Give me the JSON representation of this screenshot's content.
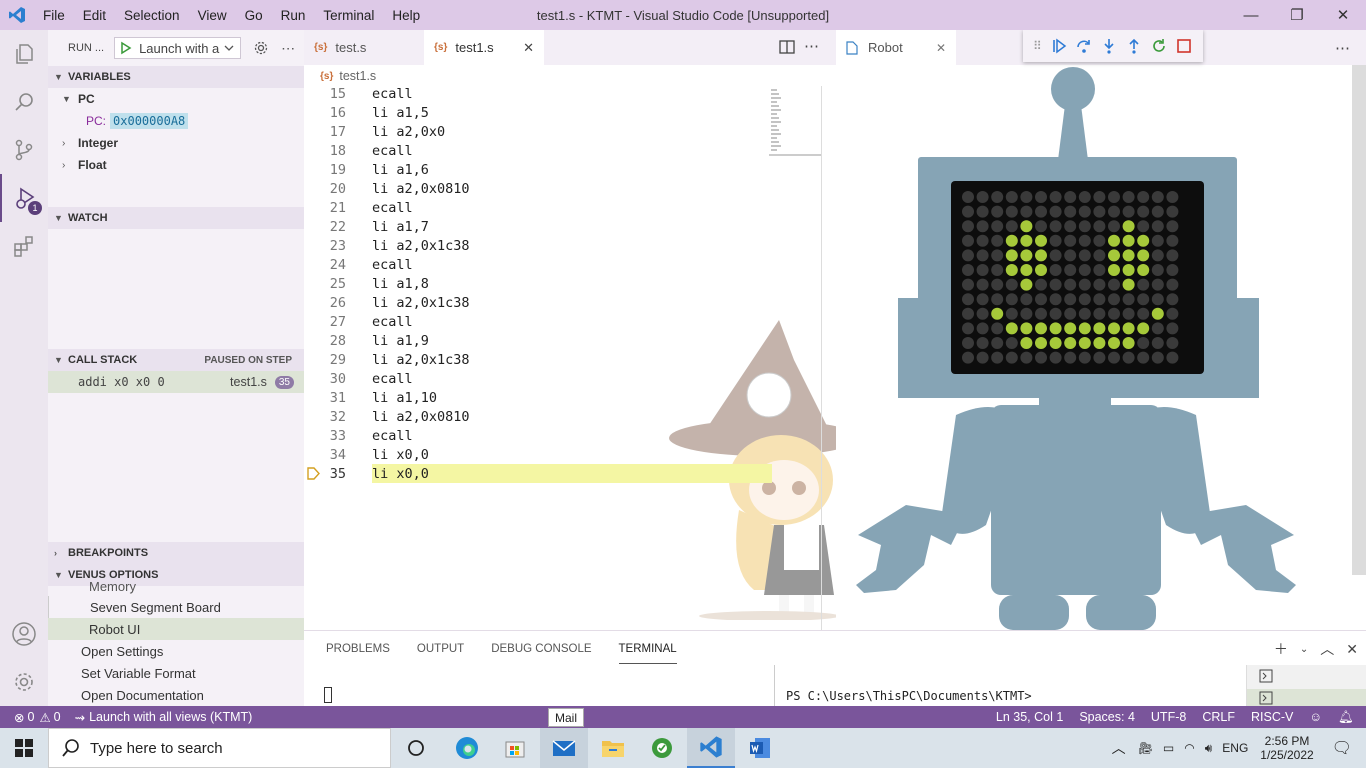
{
  "window": {
    "title": "test1.s - KTMT - Visual Studio Code [Unsupported]",
    "min": "—",
    "max": "❐",
    "close": "✕"
  },
  "menu": [
    "File",
    "Edit",
    "Selection",
    "View",
    "Go",
    "Run",
    "Terminal",
    "Help"
  ],
  "activity": {
    "debug_badge": "1"
  },
  "run": {
    "label": "RUN ...",
    "config": "Launch with a"
  },
  "variables": {
    "header": "VARIABLES",
    "pc_group": "PC",
    "pc_label": "PC:",
    "pc_value": "0x000000A8",
    "integer": "Integer",
    "float": "Float"
  },
  "watch": {
    "header": "WATCH"
  },
  "callstack": {
    "header": "CALL STACK",
    "state": "PAUSED ON STEP",
    "frame": "addi x0 x0 0",
    "file": "test1.s",
    "line": "35"
  },
  "breakpoints": {
    "header": "BREAKPOINTS"
  },
  "venus": {
    "header": "VENUS OPTIONS",
    "items": [
      "Memory",
      "Seven Segment Board",
      "Robot UI",
      "Open Settings",
      "Set Variable Format",
      "Open Documentation"
    ]
  },
  "tabs": [
    {
      "label": "test.s",
      "icon": "{s}"
    },
    {
      "label": "test1.s",
      "icon": "{s}"
    }
  ],
  "breadcrumb": "test1.s",
  "code": [
    {
      "n": "15",
      "t": "ecall"
    },
    {
      "n": "16",
      "t": "li a1,5"
    },
    {
      "n": "17",
      "t": "li a2,0x0"
    },
    {
      "n": "18",
      "t": "ecall"
    },
    {
      "n": "19",
      "t": "li a1,6"
    },
    {
      "n": "20",
      "t": "li a2,0x0810"
    },
    {
      "n": "21",
      "t": "ecall"
    },
    {
      "n": "22",
      "t": "li a1,7"
    },
    {
      "n": "23",
      "t": "li a2,0x1c38"
    },
    {
      "n": "24",
      "t": "ecall"
    },
    {
      "n": "25",
      "t": "li a1,8"
    },
    {
      "n": "26",
      "t": "li a2,0x1c38"
    },
    {
      "n": "27",
      "t": "ecall"
    },
    {
      "n": "28",
      "t": "li a1,9"
    },
    {
      "n": "29",
      "t": "li a2,0x1c38"
    },
    {
      "n": "30",
      "t": "ecall"
    },
    {
      "n": "31",
      "t": "li a1,10"
    },
    {
      "n": "32",
      "t": "li a2,0x0810"
    },
    {
      "n": "33",
      "t": "ecall"
    },
    {
      "n": "34",
      "t": "li x0,0"
    },
    {
      "n": "35",
      "t": "li x0,0"
    }
  ],
  "robot": {
    "tab": "Robot"
  },
  "panel": {
    "tabs": [
      "PROBLEMS",
      "OUTPUT",
      "DEBUG CONSOLE",
      "TERMINAL"
    ],
    "prompt": "PS C:\\Users\\ThisPC\\Documents\\KTMT>"
  },
  "status": {
    "errors": "0",
    "warnings": "0",
    "launch": "Launch with all views (KTMT)",
    "position": "Ln 35, Col 1",
    "spaces": "Spaces: 4",
    "encoding": "UTF-8",
    "eol": "CRLF",
    "lang": "RISC-V"
  },
  "tooltip": "Mail",
  "taskbar": {
    "search": "Type here to search",
    "lang": "ENG",
    "time": "2:56 PM",
    "date": "1/25/2022"
  },
  "colors": {
    "titlebar": "#ddc9e7",
    "statusbar": "#7a559b",
    "robot": "#86a4b5",
    "led_on": "#a6c93a",
    "current_line": "#f4f6a3"
  }
}
